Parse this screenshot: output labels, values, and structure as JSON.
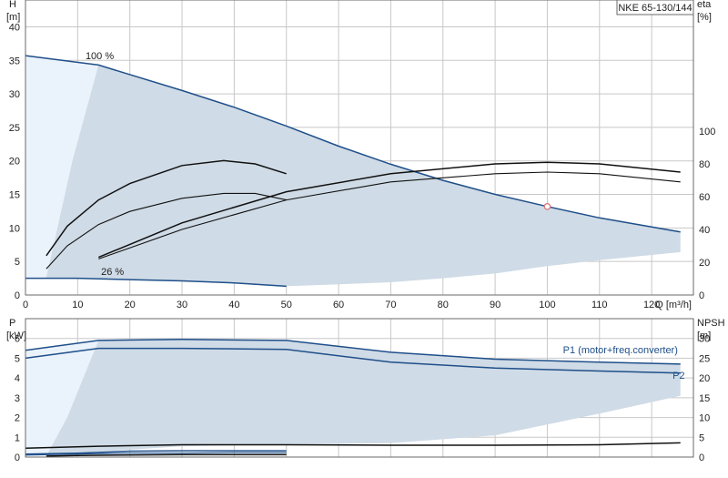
{
  "colors": {
    "area_fill": "#cfdbe6",
    "light_fill": "#eaf2fb",
    "curve_blue": "#1f4f8a",
    "curve_black": "#111111",
    "duty_point": "#e07070"
  },
  "chart_data": [
    {
      "type": "line",
      "id": "performance",
      "title": "NKE 65-130/144",
      "xlabel": "Q [m³/h]",
      "y_left_label_top": "H",
      "y_left_label_unit": "[m]",
      "y_right_label_top": "eta",
      "y_right_label_unit": "[%]",
      "xlim": [
        0,
        128
      ],
      "ylim": [
        0,
        44
      ],
      "y_right_lim": [
        0,
        180
      ],
      "xticks": [
        0,
        10,
        20,
        30,
        40,
        50,
        60,
        70,
        80,
        90,
        100,
        110,
        120
      ],
      "yticks": [
        0,
        5,
        10,
        15,
        20,
        25,
        30,
        35,
        40
      ],
      "y_right_ticks": [
        0,
        20,
        40,
        60,
        80,
        100
      ],
      "grid": true,
      "annotations": [
        {
          "text": "100 %",
          "x": 11.5,
          "y": 35.2
        },
        {
          "text": "26 %",
          "x": 14.5,
          "y": 3.0
        }
      ],
      "operating_area": [
        [
          0,
          35.7
        ],
        [
          14,
          34.3
        ],
        [
          30,
          30.5
        ],
        [
          40,
          28.0
        ],
        [
          50,
          25.2
        ],
        [
          60,
          22.2
        ],
        [
          70,
          19.5
        ],
        [
          80,
          17.1
        ],
        [
          90,
          15.0
        ],
        [
          100,
          13.2
        ],
        [
          110,
          11.5
        ],
        [
          125.5,
          9.4
        ],
        [
          125.5,
          6.4
        ],
        [
          110,
          5.2
        ],
        [
          100,
          4.3
        ],
        [
          90,
          3.2
        ],
        [
          80,
          2.5
        ],
        [
          70,
          1.9
        ],
        [
          60,
          1.6
        ],
        [
          50,
          1.3
        ],
        [
          40,
          1.8
        ],
        [
          30,
          2.1
        ],
        [
          20,
          2.3
        ],
        [
          10,
          2.5
        ],
        [
          0,
          2.5
        ]
      ],
      "light_area": [
        [
          0,
          35.7
        ],
        [
          14,
          34.3
        ],
        [
          9,
          20
        ],
        [
          4,
          2.6
        ],
        [
          0,
          2.5
        ]
      ],
      "series": [
        {
          "name": "",
          "role": "head_max",
          "axis": "left",
          "color": "#1f4f8a",
          "x": [
            0,
            14,
            30,
            40,
            50,
            60,
            70,
            80,
            90,
            100,
            110,
            125.5
          ],
          "y": [
            35.7,
            34.3,
            30.5,
            28.0,
            25.2,
            22.2,
            19.5,
            17.1,
            15.0,
            13.2,
            11.5,
            9.4
          ]
        },
        {
          "name": "",
          "role": "head_min",
          "axis": "left",
          "color": "#1f4f8a",
          "x": [
            0,
            10,
            20,
            30,
            40,
            50
          ],
          "y": [
            2.5,
            2.5,
            2.3,
            2.1,
            1.8,
            1.3
          ]
        },
        {
          "name": "",
          "role": "eta_full",
          "axis": "right",
          "color": "#111111",
          "x": [
            14,
            30,
            50,
            70,
            90,
            100,
            110,
            125.5
          ],
          "y": [
            23,
            44,
            63,
            74,
            80,
            81,
            80,
            75
          ]
        },
        {
          "name": "",
          "role": "eta_full_2",
          "axis": "right",
          "color": "#111111",
          "x": [
            14,
            30,
            50,
            70,
            90,
            100,
            110,
            125.5
          ],
          "y": [
            22,
            40,
            58,
            69,
            74,
            75,
            74,
            69
          ]
        },
        {
          "name": "",
          "role": "eta_low",
          "axis": "right",
          "color": "#111111",
          "x": [
            4,
            8,
            14,
            20,
            30,
            38,
            44,
            50
          ],
          "y": [
            24,
            42,
            58,
            68,
            79,
            82,
            80,
            74
          ]
        },
        {
          "name": "",
          "role": "eta_low_2",
          "axis": "right",
          "color": "#111111",
          "x": [
            4,
            8,
            14,
            20,
            30,
            38,
            44,
            50
          ],
          "y": [
            16,
            30,
            43,
            51,
            59,
            62,
            62,
            58
          ]
        }
      ],
      "duty_point": {
        "x": 100,
        "y": 13.2
      }
    },
    {
      "type": "line",
      "id": "power",
      "xlabel": "",
      "y_left_label_top": "P",
      "y_left_label_unit": "[kW]",
      "y_right_label_top": "NPSH",
      "y_right_label_unit": "[m]",
      "xlim": [
        0,
        128
      ],
      "ylim": [
        0,
        7
      ],
      "y_right_lim": [
        0,
        35
      ],
      "yticks": [
        0,
        1,
        2,
        3,
        4,
        5,
        6
      ],
      "y_right_ticks": [
        0,
        5,
        10,
        15,
        20,
        25,
        30
      ],
      "grid": true,
      "operating_area": [
        [
          0,
          5.4
        ],
        [
          14,
          5.9
        ],
        [
          30,
          5.95
        ],
        [
          50,
          5.9
        ],
        [
          70,
          5.3
        ],
        [
          90,
          4.95
        ],
        [
          110,
          4.8
        ],
        [
          125.5,
          4.75
        ],
        [
          125.5,
          3.1
        ],
        [
          110,
          2.2
        ],
        [
          90,
          1.1
        ],
        [
          70,
          0.7
        ],
        [
          50,
          0.65
        ],
        [
          30,
          0.55
        ],
        [
          10,
          0.2
        ],
        [
          0,
          0.05
        ]
      ],
      "light_area": [
        [
          0,
          5.4
        ],
        [
          14,
          5.9
        ],
        [
          8,
          2.0
        ],
        [
          4,
          0.05
        ],
        [
          0,
          0.05
        ]
      ],
      "series": [
        {
          "name": "P1 (motor+freq.converter)",
          "axis": "left",
          "color": "#1f4f8a",
          "x": [
            0,
            14,
            30,
            50,
            70,
            90,
            110,
            125.5
          ],
          "y": [
            5.4,
            5.9,
            5.95,
            5.9,
            5.3,
            4.95,
            4.8,
            4.7
          ]
        },
        {
          "name": "P2",
          "axis": "left",
          "color": "#1f4f8a",
          "x": [
            0,
            14,
            30,
            50,
            70,
            90,
            110,
            125.5
          ],
          "y": [
            5.0,
            5.5,
            5.5,
            5.45,
            4.8,
            4.5,
            4.35,
            4.25
          ]
        },
        {
          "name": "",
          "role": "npsh",
          "axis": "left",
          "color": "#111111",
          "x": [
            0,
            14,
            30,
            50,
            70,
            90,
            110,
            125.5
          ],
          "y": [
            0.45,
            0.55,
            0.62,
            0.62,
            0.6,
            0.6,
            0.62,
            0.72
          ]
        },
        {
          "name": "",
          "role": "p_min_1",
          "axis": "left",
          "color": "#1f4f8a",
          "x": [
            0,
            10,
            20,
            30,
            40,
            50
          ],
          "y": [
            0.15,
            0.2,
            0.3,
            0.32,
            0.32,
            0.32
          ]
        },
        {
          "name": "",
          "role": "p_min_2",
          "axis": "left",
          "color": "#1f4f8a",
          "x": [
            0,
            10,
            20,
            30,
            40,
            50
          ],
          "y": [
            0.1,
            0.15,
            0.2,
            0.2,
            0.22,
            0.22
          ]
        },
        {
          "name": "",
          "role": "p_min_3",
          "axis": "left",
          "color": "#111111",
          "x": [
            4,
            10,
            20,
            30,
            40,
            50
          ],
          "y": [
            0.05,
            0.08,
            0.1,
            0.12,
            0.12,
            0.12
          ]
        }
      ],
      "series_labels": [
        {
          "series": "P1 (motor+freq.converter)",
          "x": 103,
          "y": 5.25
        },
        {
          "series": "P2",
          "x": 124,
          "y": 3.95
        }
      ]
    }
  ]
}
